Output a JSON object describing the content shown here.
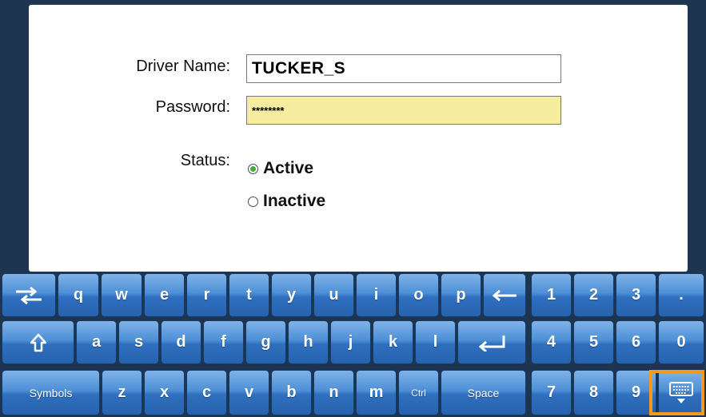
{
  "form": {
    "driver_name_label": "Driver Name:",
    "driver_name_value": "TUCKER_S",
    "password_label": "Password:",
    "password_value": "********",
    "status_label": "Status:",
    "status_options": [
      {
        "label": "Active",
        "selected": true
      },
      {
        "label": "Inactive",
        "selected": false
      }
    ]
  },
  "keyboard": {
    "row1_letters": [
      "q",
      "w",
      "e",
      "r",
      "t",
      "y",
      "u",
      "i",
      "o",
      "p"
    ],
    "row2_letters": [
      "a",
      "s",
      "d",
      "f",
      "g",
      "h",
      "j",
      "k",
      "l"
    ],
    "row3_letters": [
      "z",
      "x",
      "c",
      "v",
      "b",
      "n",
      "m"
    ],
    "numpad": [
      "1",
      "2",
      "3",
      ".",
      "4",
      "5",
      "6",
      "0",
      "7",
      "8",
      "9"
    ],
    "symbols_label": "Symbols",
    "ctrl_label": "Ctrl",
    "space_label": "Space",
    "tab_icon": "tab-arrows-icon",
    "backspace_icon": "backspace-arrow-icon",
    "shift_icon": "shift-up-arrow-icon",
    "enter_icon": "enter-return-icon",
    "hide_keyboard_icon": "keyboard-hide-icon"
  },
  "colors": {
    "background": "#1d3550",
    "key_blue": "#3a7ccc",
    "password_field_bg": "#f7eda0",
    "radio_selected": "#3fae3a",
    "highlight": "#f39a1e"
  }
}
